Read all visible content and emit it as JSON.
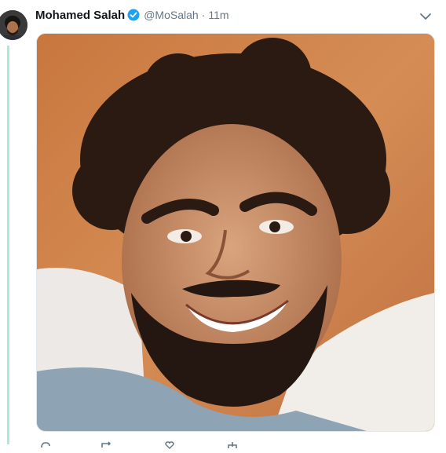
{
  "tweet": {
    "author_name": "Mohamed Salah",
    "handle": "@MoSalah",
    "separator": "·",
    "timestamp": "11m",
    "verified": true,
    "accent_color": "#1da1f2",
    "thread_line_color": "#b1e6d8",
    "media": {
      "type": "photo",
      "description_icon": "selfie-photo"
    },
    "action_icons": [
      "reply-icon",
      "retweet-icon",
      "like-icon",
      "share-icon"
    ]
  }
}
